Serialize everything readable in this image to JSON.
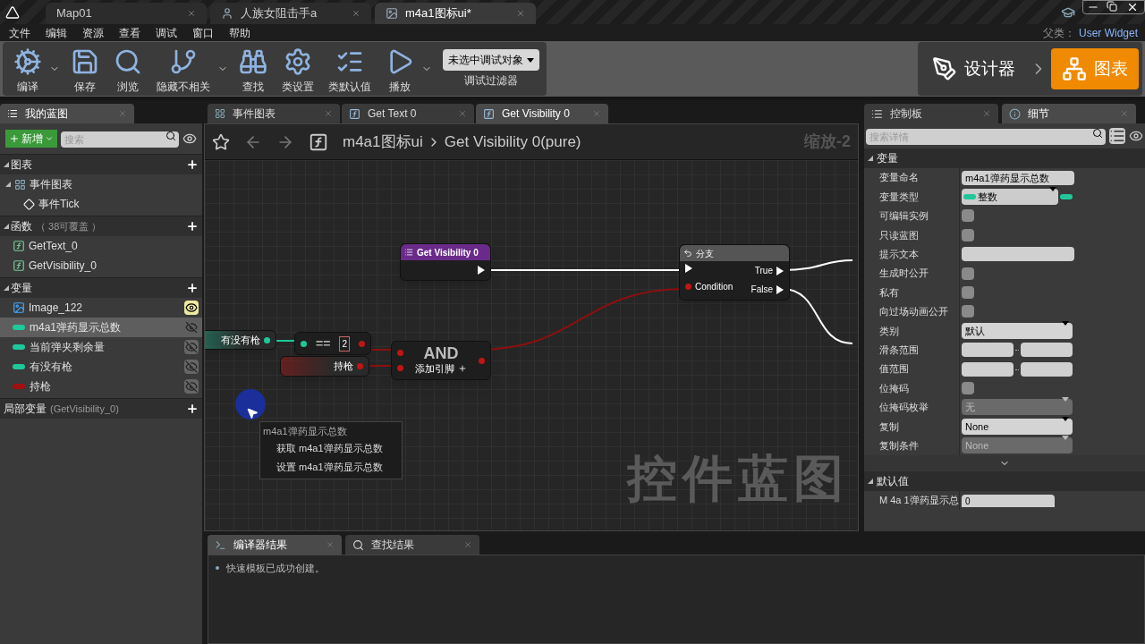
{
  "title_bar": {
    "tabs": [
      {
        "label": "Map01",
        "kind": "level",
        "selected": false
      },
      {
        "label": "人族女阻击手a",
        "kind": "character",
        "selected": false
      },
      {
        "label": "m4a1图标ui*",
        "kind": "widget",
        "selected": true
      }
    ]
  },
  "menu_bar": {
    "items": [
      "文件",
      "编辑",
      "资源",
      "查看",
      "调试",
      "窗口",
      "帮助"
    ],
    "parent_label": "父类：",
    "parent_value": "User Widget"
  },
  "toolbar": {
    "buttons": [
      {
        "label": "编译",
        "kind": "compile",
        "dropdown": true
      },
      {
        "label": "保存",
        "kind": "save",
        "dropdown": false
      },
      {
        "label": "浏览",
        "kind": "browse",
        "dropdown": false
      },
      {
        "label": "隐藏不相关",
        "kind": "hide",
        "dropdown": true
      },
      {
        "label": "查找",
        "kind": "find",
        "dropdown": false
      },
      {
        "label": "类设置",
        "kind": "settings",
        "dropdown": false
      },
      {
        "label": "类默认值",
        "kind": "defaults",
        "dropdown": false
      },
      {
        "label": "播放",
        "kind": "play",
        "dropdown": true
      }
    ],
    "debug_select": "未选中调试对象",
    "debug_label": "调试过滤器",
    "modes": [
      {
        "label": "设计器",
        "kind": "designer",
        "selected": false
      },
      {
        "label": "图表",
        "kind": "graph",
        "selected": true
      }
    ]
  },
  "my_blueprint": {
    "tab": "我的蓝图",
    "add_button": "新增",
    "search_placeholder": "搜索",
    "sections": [
      {
        "title": "图表",
        "items": [
          {
            "label": "事件图表",
            "kind": "graph",
            "selected": false,
            "expanded": true,
            "children": [
              {
                "label": "事件Tick",
                "kind": "event",
                "selected": false
              }
            ]
          }
        ]
      },
      {
        "title": "函数",
        "note": "（ 38可覆盖 ）",
        "items": [
          {
            "label": "GetText_0",
            "kind": "function",
            "selected": false
          },
          {
            "label": "GetVisibility_0",
            "kind": "function",
            "selected": false
          }
        ]
      },
      {
        "title": "变量",
        "items": [
          {
            "label": "Image_122",
            "kind": "widget",
            "selected": false
          },
          {
            "label": "m4a1弹药显示总数",
            "kind": "variable",
            "color": "#1fc89a",
            "selected": true
          },
          {
            "label": "当前弹夹剩余量",
            "kind": "variable",
            "color": "#1fc89a",
            "selected": false
          },
          {
            "label": "有没有枪",
            "kind": "variable",
            "color": "#1fc89a",
            "selected": false
          },
          {
            "label": "持枪",
            "kind": "variable",
            "color": "#a01010",
            "selected": false
          }
        ]
      },
      {
        "title": "局部变量",
        "note": "(GetVisibility_0)"
      }
    ]
  },
  "graph_tabs": [
    {
      "label": "事件图表",
      "kind": "graph",
      "selected": false
    },
    {
      "label": "Get Text 0",
      "kind": "function",
      "selected": false
    },
    {
      "label": "Get Visibility 0",
      "kind": "function",
      "selected": true
    }
  ],
  "graph": {
    "breadcrumb": [
      "m4a1图标ui",
      "Get Visibility 0(pure)"
    ],
    "zoom": "缩放-2",
    "watermark": "控件蓝图",
    "nodes": [
      {
        "kind": "function_entry",
        "title": "Get Visibility 0"
      },
      {
        "kind": "branch",
        "title": "分支",
        "input": "Condition",
        "outputs": [
          "True",
          "False"
        ]
      },
      {
        "kind": "variable_get",
        "label": "有没有枪",
        "color": "#1fc89a"
      },
      {
        "kind": "compare",
        "title": "==",
        "literal": "2"
      },
      {
        "kind": "variable_get",
        "label": "持枪",
        "color": "#c01515"
      },
      {
        "kind": "and",
        "title": "AND",
        "footer": "添加引脚"
      }
    ],
    "context_menu": {
      "title": "m4a1弹药显示总数",
      "items": [
        "获取 m4a1弹药显示总数",
        "设置 m4a1弹药显示总数"
      ]
    }
  },
  "details": {
    "tabs": [
      {
        "label": "控制板",
        "kind": "palette",
        "selected": false
      },
      {
        "label": "细节",
        "kind": "details",
        "selected": true
      }
    ],
    "search_placeholder": "搜索详情",
    "sections": [
      {
        "title": "变量",
        "expanded": true,
        "more": true,
        "rows": [
          {
            "label": "变量命名",
            "kind": "field",
            "value": "m4a1弹药显示总数"
          },
          {
            "label": "变量类型",
            "kind": "type",
            "value": "整数",
            "color": "#1fc89a"
          },
          {
            "label": "可编辑实例",
            "kind": "checkbox",
            "checked": false
          },
          {
            "label": "只读蓝图",
            "kind": "checkbox",
            "checked": false
          },
          {
            "label": "提示文本",
            "kind": "field"
          },
          {
            "label": "生成时公开",
            "kind": "checkbox",
            "checked": false
          },
          {
            "label": "私有",
            "kind": "checkbox",
            "checked": false
          },
          {
            "label": "向过场动画公开",
            "kind": "checkbox",
            "checked": false
          },
          {
            "label": "类别",
            "kind": "select",
            "value": "默认",
            "disabled": false
          },
          {
            "label": "滑条范围",
            "kind": "range"
          },
          {
            "label": "值范围",
            "kind": "range"
          },
          {
            "label": "位掩码",
            "kind": "checkbox",
            "checked": false
          },
          {
            "label": "位掩码枚举",
            "kind": "select",
            "value": "无",
            "disabled": true
          },
          {
            "label": "复制",
            "kind": "select",
            "value": "None",
            "disabled": false
          },
          {
            "label": "复制条件",
            "kind": "select",
            "value": "None",
            "disabled": true
          }
        ]
      },
      {
        "title": "默认值",
        "expanded": true,
        "more": false,
        "rows": [
          {
            "label": "M 4a 1弹药显示总",
            "kind": "number",
            "value": "0"
          }
        ]
      }
    ]
  },
  "results": {
    "tabs": [
      {
        "label": "编译器结果",
        "kind": "compiler",
        "selected": true
      },
      {
        "label": "查找结果",
        "kind": "find",
        "selected": false
      }
    ],
    "messages": [
      "快速模板已成功创建。"
    ]
  }
}
